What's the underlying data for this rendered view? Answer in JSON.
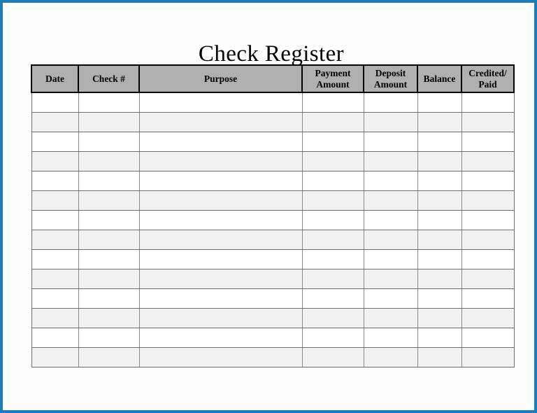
{
  "page": {
    "title": "Check Register",
    "border_color": "#1b7cb8",
    "background_color": "#fdfdfd"
  },
  "table": {
    "header_fill": "#b0b0b0",
    "shaded_row_fill": "#f2f2f2",
    "plain_row_fill": "#ffffff",
    "grid_color": "#6e6e6e",
    "columns": [
      {
        "key": "date",
        "label": "Date"
      },
      {
        "key": "check_no",
        "label": "Check #"
      },
      {
        "key": "purpose",
        "label": "Purpose"
      },
      {
        "key": "payment",
        "label": "Payment\nAmount"
      },
      {
        "key": "deposit",
        "label": "Deposit\nAmount"
      },
      {
        "key": "balance",
        "label": "Balance"
      },
      {
        "key": "credited",
        "label": "Credited/\nPaid"
      }
    ],
    "row_count": 14,
    "rows": [
      {
        "date": "",
        "check_no": "",
        "purpose": "",
        "payment": "",
        "deposit": "",
        "balance": "",
        "credited": ""
      },
      {
        "date": "",
        "check_no": "",
        "purpose": "",
        "payment": "",
        "deposit": "",
        "balance": "",
        "credited": ""
      },
      {
        "date": "",
        "check_no": "",
        "purpose": "",
        "payment": "",
        "deposit": "",
        "balance": "",
        "credited": ""
      },
      {
        "date": "",
        "check_no": "",
        "purpose": "",
        "payment": "",
        "deposit": "",
        "balance": "",
        "credited": ""
      },
      {
        "date": "",
        "check_no": "",
        "purpose": "",
        "payment": "",
        "deposit": "",
        "balance": "",
        "credited": ""
      },
      {
        "date": "",
        "check_no": "",
        "purpose": "",
        "payment": "",
        "deposit": "",
        "balance": "",
        "credited": ""
      },
      {
        "date": "",
        "check_no": "",
        "purpose": "",
        "payment": "",
        "deposit": "",
        "balance": "",
        "credited": ""
      },
      {
        "date": "",
        "check_no": "",
        "purpose": "",
        "payment": "",
        "deposit": "",
        "balance": "",
        "credited": ""
      },
      {
        "date": "",
        "check_no": "",
        "purpose": "",
        "payment": "",
        "deposit": "",
        "balance": "",
        "credited": ""
      },
      {
        "date": "",
        "check_no": "",
        "purpose": "",
        "payment": "",
        "deposit": "",
        "balance": "",
        "credited": ""
      },
      {
        "date": "",
        "check_no": "",
        "purpose": "",
        "payment": "",
        "deposit": "",
        "balance": "",
        "credited": ""
      },
      {
        "date": "",
        "check_no": "",
        "purpose": "",
        "payment": "",
        "deposit": "",
        "balance": "",
        "credited": ""
      },
      {
        "date": "",
        "check_no": "",
        "purpose": "",
        "payment": "",
        "deposit": "",
        "balance": "",
        "credited": ""
      },
      {
        "date": "",
        "check_no": "",
        "purpose": "",
        "payment": "",
        "deposit": "",
        "balance": "",
        "credited": ""
      }
    ]
  }
}
